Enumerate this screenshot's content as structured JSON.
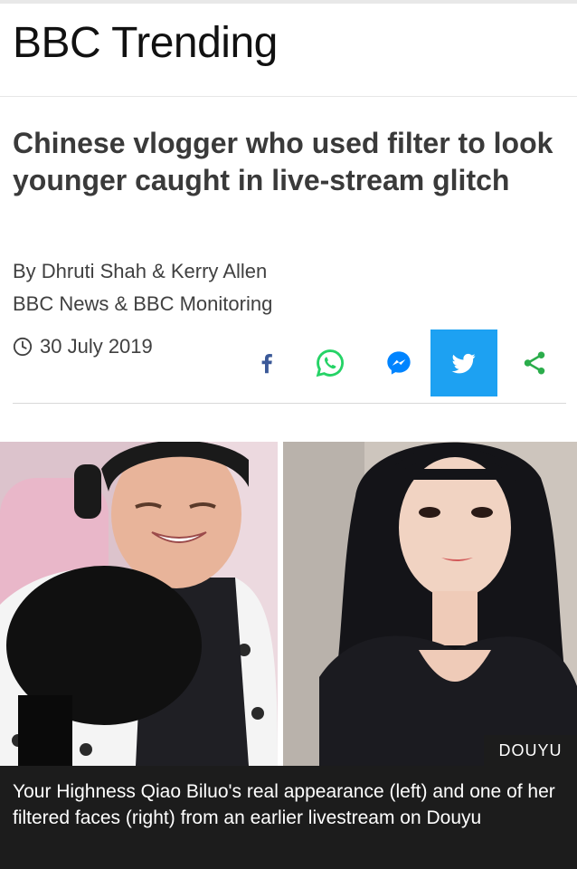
{
  "header": {
    "title": "BBC Trending"
  },
  "article": {
    "headline": "Chinese vlogger who used filter to look younger caught in live-stream glitch",
    "byline": "By Dhruti Shah & Kerry Allen",
    "organisation": "BBC News & BBC Monitoring",
    "date": "30 July 2019"
  },
  "share": {
    "buttons": [
      {
        "name": "facebook-icon",
        "color": "#3b5998"
      },
      {
        "name": "whatsapp-icon",
        "color": "#25d366"
      },
      {
        "name": "messenger-icon",
        "color": "#0084ff"
      },
      {
        "name": "twitter-icon",
        "color": "#1da1f2"
      },
      {
        "name": "share-icon",
        "color": "#2bad4b"
      }
    ]
  },
  "image": {
    "credit": "DOUYU",
    "caption": "Your Highness Qiao Biluo's real appearance (left) and one of her filtered faces (right) from an earlier livestream on Douyu"
  }
}
